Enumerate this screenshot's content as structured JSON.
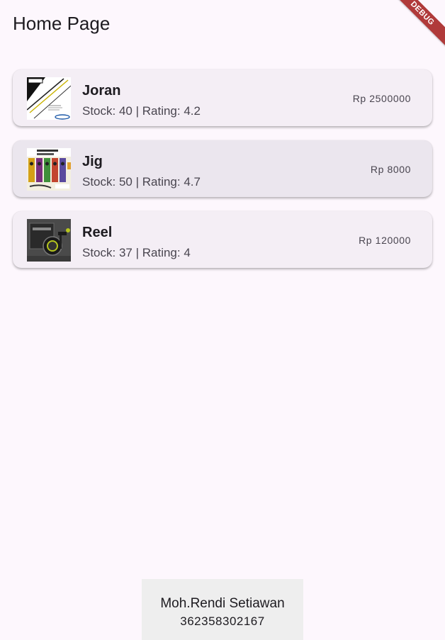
{
  "appbar": {
    "title": "Home Page",
    "debug_label": "DEBUG"
  },
  "products": [
    {
      "name": "Joran",
      "meta": "Stock: 40 | Rating: 4.2",
      "price": "Rp 2500000",
      "image": "fishing-rod-image"
    },
    {
      "name": "Jig",
      "meta": "Stock: 50 | Rating: 4.7",
      "price": "Rp 8000",
      "image": "jig-lures-image"
    },
    {
      "name": "Reel",
      "meta": "Stock: 37 | Rating: 4",
      "price": "Rp 120000",
      "image": "fishing-reel-image"
    }
  ],
  "footer": {
    "author": "Moh.Rendi Setiawan",
    "student_id": "362358302167"
  },
  "colors": {
    "background": "#fdf7fd",
    "card": "#f4eef5",
    "card_selected": "#ebe6ee",
    "debug_banner": "#b03a3a",
    "footer": "#eeeeee"
  }
}
